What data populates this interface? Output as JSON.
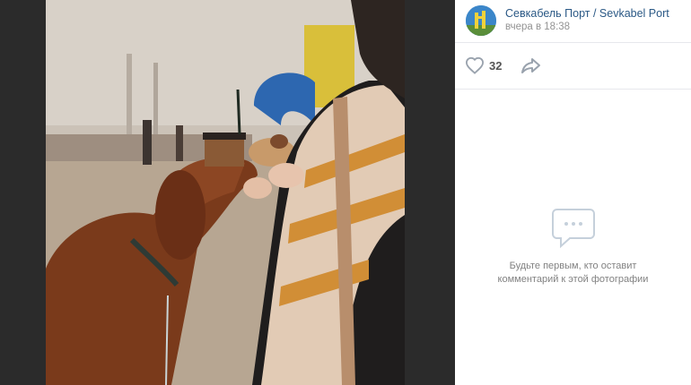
{
  "author": {
    "name": "Севкабель Порт / Sevkabel Port",
    "time": "вчера в 18:38"
  },
  "actions": {
    "like_count": "32",
    "like_icon": "heart-outline-icon",
    "share_icon": "share-arrow-icon"
  },
  "comments": {
    "empty_line1": "Будьте первым, кто оставит",
    "empty_line2": "комментарий к этой фотографии",
    "icon": "comment-bubble-icon"
  },
  "colors": {
    "link": "#2a5885",
    "muted": "#939393",
    "icon_gray": "#99a2ad",
    "viewer_bg": "#2b2b2b"
  }
}
